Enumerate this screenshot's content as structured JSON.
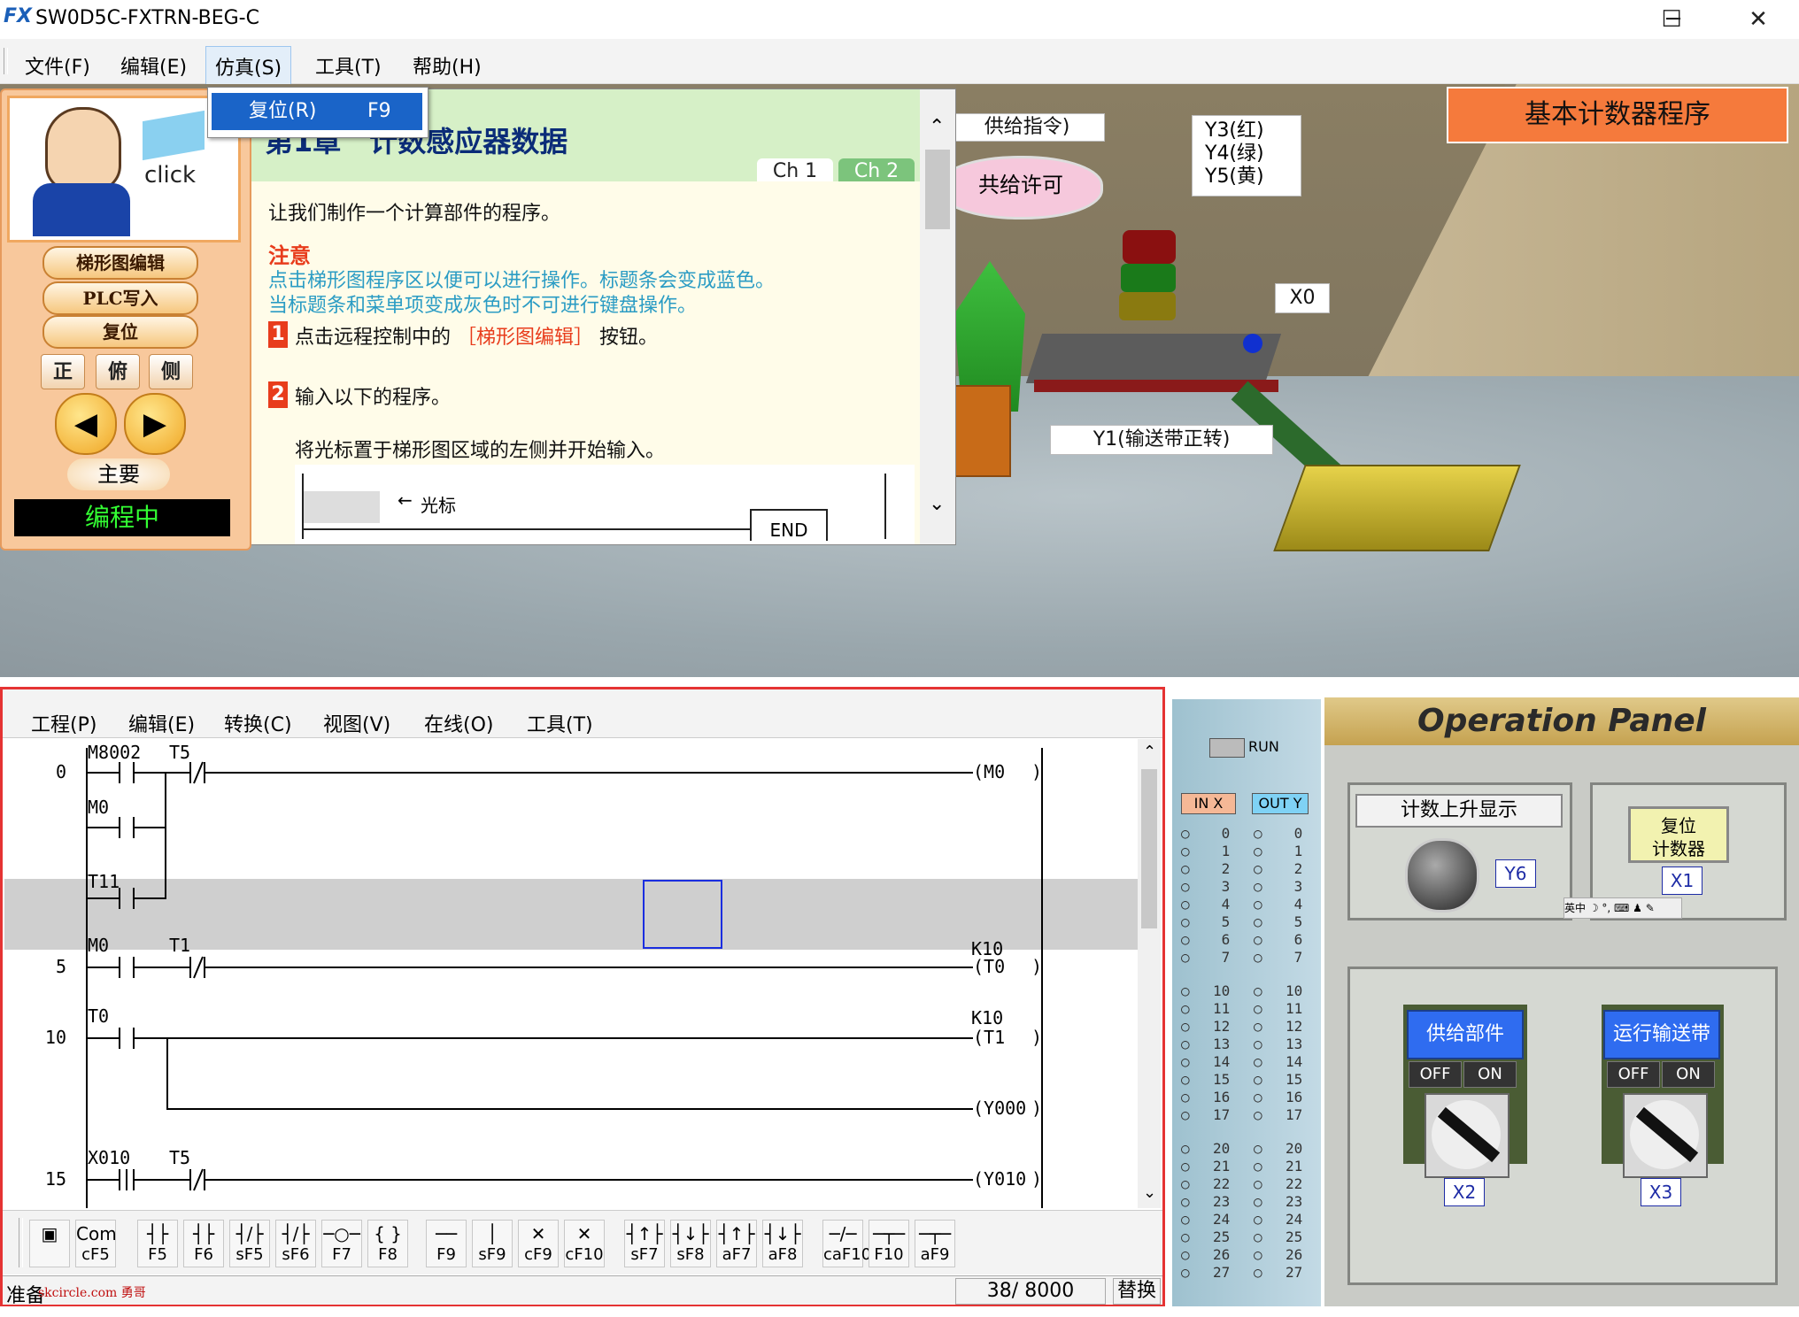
{
  "window": {
    "title": "SW0D5C-FXTRN-BEG-C",
    "logo_text": "FX",
    "minimize": "─",
    "maximize": "☐",
    "close": "✕"
  },
  "menubar": {
    "items": [
      "文件(F)",
      "编辑(E)",
      "仿真(S)",
      "工具(T)",
      "帮助(H)"
    ]
  },
  "dropdown": {
    "item_label": "复位(R)",
    "item_shortcut": "F9"
  },
  "tutor_panel": {
    "avatar_caption": "click",
    "buttons": [
      "梯形图编辑",
      "PLC写入",
      "复位"
    ],
    "view_buttons": [
      "正",
      "俯",
      "侧"
    ],
    "prev": "◀",
    "next": "▶",
    "main": "主要",
    "status": "编程中"
  },
  "lesson": {
    "title": "第1章　计数感应器数据",
    "tabs": [
      "Ch 1",
      "Ch 2"
    ],
    "intro": "让我们制作一个计算部件的程序。",
    "note_title": "注意",
    "note_lines": [
      "点击梯形图程序区以便可以进行操作。标题条会变成蓝色。",
      "当标题条和菜单项变成灰色时不可进行键盘操作。"
    ],
    "step1_num": "1",
    "step1_pre": "点击远程控制中的",
    "step1_highlight": "［梯形图编辑］",
    "step1_post": "按钮。",
    "step2_num": "2",
    "step2": "输入以下的程序。",
    "cursor_hint": "将光标置于梯形图区域的左侧并开始输入。",
    "cursor_label": "光标",
    "end_label": "END"
  },
  "scene": {
    "title_badge": "基本计数器程序",
    "supply_cmd": "供给指令)",
    "supply_permit": "共给许可",
    "lamp_labels": [
      "Y3(红)",
      "Y4(绿)",
      "Y5(黄)"
    ],
    "x0": "X0",
    "y1": "Y1(输送带正转)"
  },
  "ladder": {
    "menu": [
      "工程(P)",
      "编辑(E)",
      "转换(C)",
      "视图(V)",
      "在线(O)",
      "工具(T)"
    ],
    "step_numbers": [
      "0",
      "5",
      "10",
      "15"
    ],
    "labels": {
      "m8002": "M8002",
      "t5a": "T5",
      "m0_coil": "(M0",
      "m0a": "M0",
      "t11": "T11",
      "m0b": "M0",
      "t1": "T1",
      "k10a": "K10",
      "t0_coil": "(T0",
      "t0": "T0",
      "k10b": "K10",
      "t1_coil": "(T1",
      "y000": "(Y000",
      "x010": "X010",
      "t5b": "T5",
      "y010": "(Y010"
    },
    "toolbar": [
      {
        "glyph": "▣",
        "key": ""
      },
      {
        "glyph": "Com",
        "key": "cF5"
      },
      {
        "glyph": "┤├",
        "key": "F5"
      },
      {
        "glyph": "┤├",
        "key": "F6"
      },
      {
        "glyph": "┤/├",
        "key": "sF5"
      },
      {
        "glyph": "┤/├",
        "key": "sF6"
      },
      {
        "glyph": "─○─",
        "key": "F7"
      },
      {
        "glyph": "{ }",
        "key": "F8"
      },
      {
        "glyph": "──",
        "key": "F9"
      },
      {
        "glyph": "│",
        "key": "sF9"
      },
      {
        "glyph": "✕",
        "key": "cF9"
      },
      {
        "glyph": "✕",
        "key": "cF10"
      },
      {
        "glyph": "┤↑├",
        "key": "sF7"
      },
      {
        "glyph": "┤↓├",
        "key": "sF8"
      },
      {
        "glyph": "┤↑├",
        "key": "aF7"
      },
      {
        "glyph": "┤↓├",
        "key": "aF8"
      },
      {
        "glyph": "─/─",
        "key": "caF10"
      },
      {
        "glyph": "─┬─",
        "key": "F10"
      },
      {
        "glyph": "─┬─",
        "key": "aF9"
      }
    ],
    "status": {
      "ready": "准备",
      "watermark": "skcircle.com 勇哥",
      "steps": "38/ 8000",
      "mode": "替换"
    }
  },
  "io_panel": {
    "run": "RUN",
    "in_header": "IN X",
    "out_header": "OUT Y",
    "numbers": [
      "0",
      "1",
      "2",
      "3",
      "4",
      "5",
      "6",
      "7",
      "10",
      "11",
      "12",
      "13",
      "14",
      "15",
      "16",
      "17",
      "20",
      "21",
      "22",
      "23",
      "24",
      "25",
      "26",
      "27"
    ]
  },
  "op_panel": {
    "title": "Operation Panel",
    "count_display": "计数上升显示",
    "y6": "Y6",
    "reset_counter": "复位\n计数器",
    "x1": "X1",
    "supply_part": "供给部件",
    "run_conveyor": "运行输送带",
    "off": "OFF",
    "on": "ON",
    "x2": "X2",
    "x3": "X3",
    "ime_toolbar": "英中 ☽ °, ⌨ ♟ ✎"
  }
}
